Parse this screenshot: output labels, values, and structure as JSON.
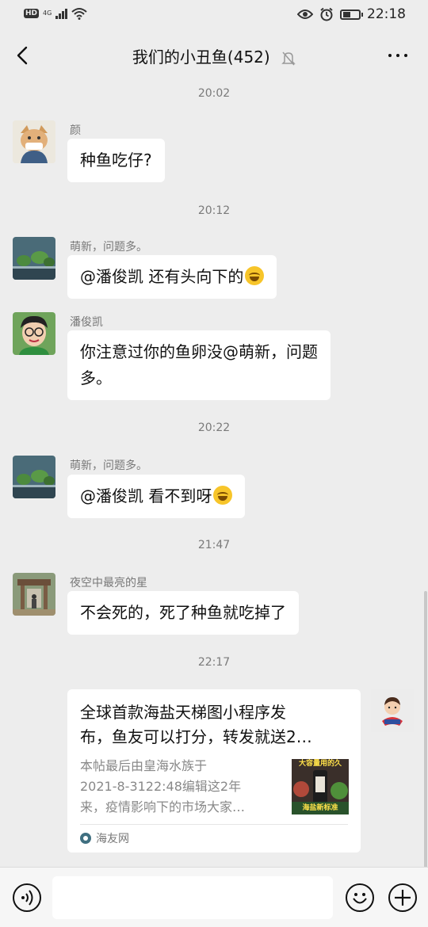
{
  "status_bar": {
    "badge": "HD",
    "network": "4G",
    "time": "22:18"
  },
  "header": {
    "title": "我们的小丑鱼(452)",
    "back_icon": "chevron-left-icon",
    "mute_icon": "bell-off-icon",
    "more_icon": "more-dots-icon"
  },
  "messages": [
    {
      "time": "20:02"
    },
    {
      "sender": "颜",
      "text": "种鱼吃仔?"
    },
    {
      "time": "20:12"
    },
    {
      "sender": "萌新，问题多。",
      "text": "@潘俊凯  还有头向下的"
    },
    {
      "sender": "潘俊凯",
      "text_line1": "你注意过你的鱼卵没@萌新，问题",
      "text_line2": "多。"
    },
    {
      "time": "20:22"
    },
    {
      "sender": "萌新，问题多。",
      "text": "@潘俊凯  看不到呀"
    },
    {
      "time": "21:47"
    },
    {
      "sender": "夜空中最亮的星",
      "text": "不会死的，死了种鱼就吃掉了"
    },
    {
      "time": "22:17"
    }
  ],
  "link_card": {
    "title_line1": "全球首款海盐天梯图小程序发",
    "title_line2": "布，鱼友可以打分，转发就送2…",
    "desc_line1": "本帖最后由皇海水族于",
    "desc_line2": "2021-8-3122:48编辑这2年",
    "desc_line3": "来，疫情影响下的市场大家…",
    "thumb_text": "大容量用的久",
    "thumb_text2": "海盐新标准",
    "source": "海友网"
  },
  "colors": {
    "background": "#ededed",
    "bubble": "#ffffff",
    "time_text": "#7a7a7a"
  },
  "input_bar": {
    "voice_icon": "voice-icon",
    "emoji_icon": "smile-icon",
    "plus_icon": "plus-icon"
  }
}
